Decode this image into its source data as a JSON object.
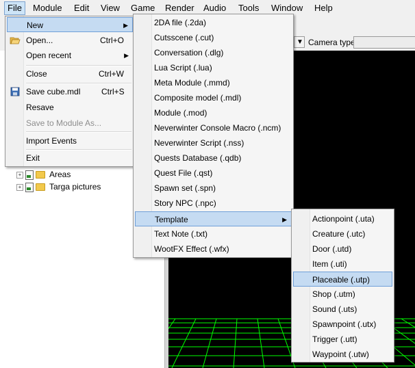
{
  "menubar": {
    "items": [
      "File",
      "Module",
      "Edit",
      "View",
      "Game",
      "Render",
      "Audio",
      "Tools",
      "Window",
      "Help"
    ]
  },
  "toolbar": {
    "camera_label": "Camera type",
    "combo_arrow": "▼"
  },
  "tree": {
    "items": [
      "Areas",
      "Targa pictures"
    ]
  },
  "file_menu": {
    "items": [
      {
        "label": "New",
        "shortcut": "",
        "submenu": true
      },
      {
        "label": "Open...",
        "shortcut": "Ctrl+O"
      },
      {
        "label": "Open recent",
        "shortcut": "",
        "submenu": true
      },
      {
        "label": "Close",
        "shortcut": "Ctrl+W"
      },
      {
        "label": "Save cube.mdl",
        "shortcut": "Ctrl+S"
      },
      {
        "label": "Resave",
        "shortcut": ""
      },
      {
        "label": "Save to Module As...",
        "shortcut": "",
        "disabled": true
      },
      {
        "label": "Import Events",
        "shortcut": ""
      },
      {
        "label": "Exit",
        "shortcut": ""
      }
    ],
    "submenu_arrow": "▶"
  },
  "new_menu": {
    "items": [
      "2DA file (.2da)",
      "Cutsscene (.cut)",
      "Conversation (.dlg)",
      "Lua Script (.lua)",
      "Meta Module (.mmd)",
      "Composite model (.mdl)",
      "Module (.mod)",
      "Neverwinter Console Macro (.ncm)",
      "Neverwinter Script (.nss)",
      "Quests Database (.qdb)",
      "Quest File (.qst)",
      "Spawn set (.spn)",
      "Story NPC (.npc)",
      "Template",
      "Text Note (.txt)",
      "WootFX Effect (.wfx)"
    ]
  },
  "template_menu": {
    "items": [
      "Actionpoint (.uta)",
      "Creature (.utc)",
      "Door (.utd)",
      "Item (.uti)",
      "Placeable (.utp)",
      "Shop (.utm)",
      "Sound (.uts)",
      "Spawnpoint (.utx)",
      "Trigger (.utt)",
      "Waypoint (.utw)"
    ]
  },
  "colors": {
    "highlight": "#c5dbf2",
    "highlight_border": "#6f9fd8",
    "viewport_bg": "#000000",
    "grid_green": "#00ff00"
  }
}
